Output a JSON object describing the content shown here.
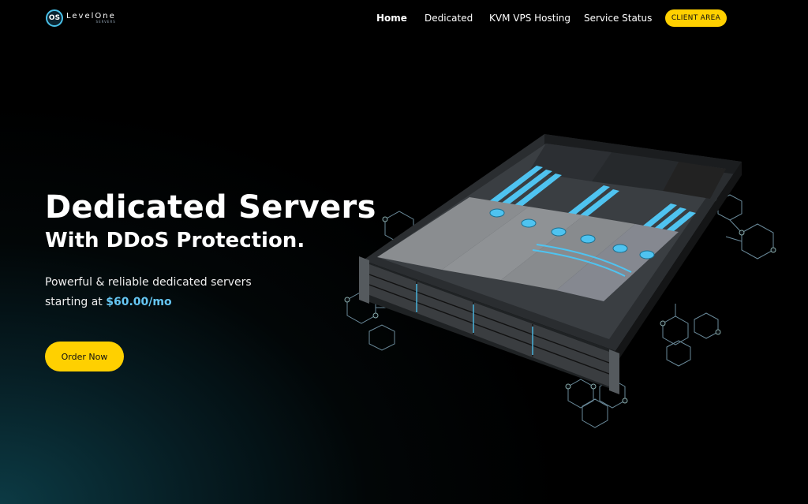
{
  "header": {
    "logo": {
      "name": "LevelOne",
      "sub": "SERVERS",
      "mark": "OS"
    },
    "nav": [
      {
        "label": "Home",
        "active": true
      },
      {
        "label": "Dedicated",
        "active": false
      },
      {
        "label": "KVM VPS Hosting",
        "active": false
      },
      {
        "label": "Service Status",
        "active": false
      }
    ],
    "client_area": "CLIENT AREA"
  },
  "hero": {
    "title": "Dedicated Servers",
    "subtitle": "With DDoS Protection.",
    "desc_line1": "Powerful & reliable dedicated servers",
    "desc_prefix": "starting at ",
    "price": "$60.00/mo",
    "cta": "Order Now"
  },
  "colors": {
    "accent_yellow": "#ffd000",
    "price_blue": "#66c7f4",
    "server_blue": "#4fc3f0"
  }
}
